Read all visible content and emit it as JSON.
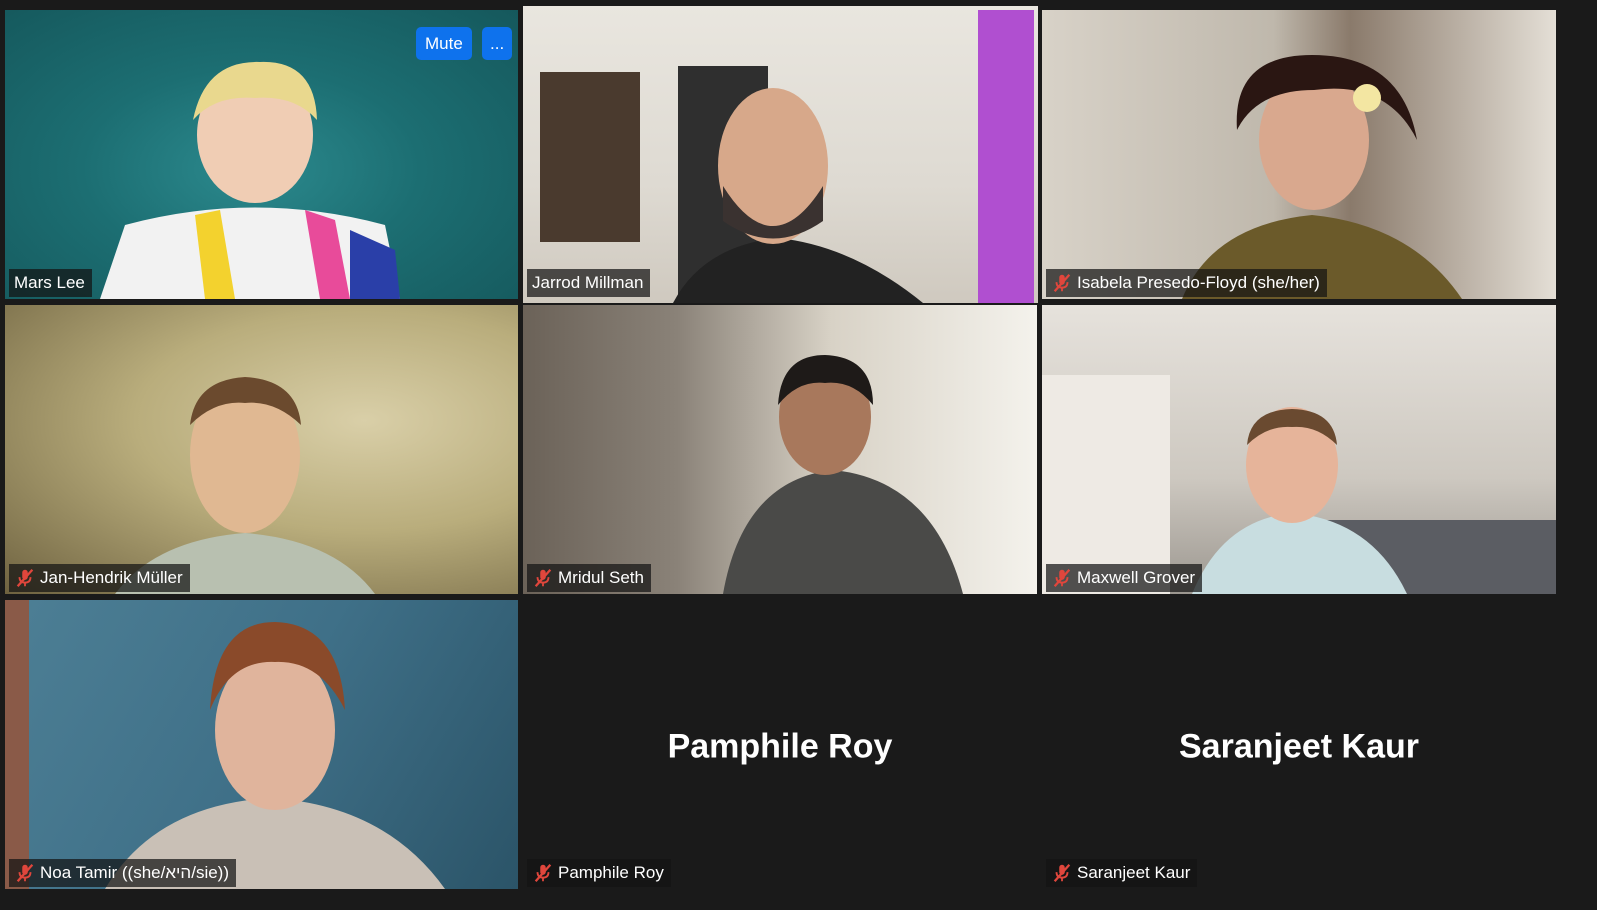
{
  "controls": {
    "mute_label": "Mute",
    "more_label": "..."
  },
  "participants": [
    {
      "name": "Mars Lee",
      "muted": false,
      "active": false,
      "video": true
    },
    {
      "name": "Jarrod Millman",
      "muted": false,
      "active": true,
      "video": true
    },
    {
      "name": "Isabela Presedo-Floyd (she/her)",
      "muted": true,
      "active": false,
      "video": true
    },
    {
      "name": "Jan-Hendrik Müller",
      "muted": true,
      "active": false,
      "video": true
    },
    {
      "name": "Mridul Seth",
      "muted": true,
      "active": false,
      "video": true
    },
    {
      "name": "Maxwell Grover",
      "muted": true,
      "active": false,
      "video": true
    },
    {
      "name": "Noa Tamir ((she/היא/sie))",
      "muted": true,
      "active": false,
      "video": true
    },
    {
      "name": "Pamphile Roy",
      "muted": true,
      "active": false,
      "video": false
    },
    {
      "name": "Saranjeet Kaur",
      "muted": true,
      "active": false,
      "video": false
    }
  ],
  "colors": {
    "active_border": "#c8e07a",
    "button": "#0e72ed",
    "muted_icon": "#e0463c"
  },
  "icons": {
    "muted": "microphone-muted-icon"
  }
}
